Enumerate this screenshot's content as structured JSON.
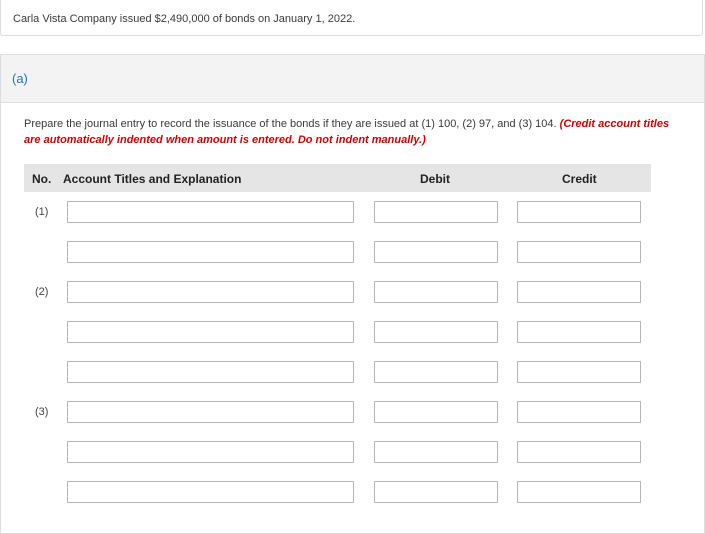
{
  "intro": {
    "text": "Carla Vista Company issued $2,490,000 of bonds on January 1, 2022."
  },
  "part": {
    "label": "(a)",
    "instructions": "Prepare the journal entry to record the issuance of the bonds if they are issued at (1) 100, (2) 97, and (3) 104.",
    "note": "(Credit account titles are automatically indented when amount is entered. Do not indent manually.)"
  },
  "table": {
    "headers": {
      "no": "No.",
      "account": "Account Titles and Explanation",
      "debit": "Debit",
      "credit": "Credit"
    },
    "rows": [
      {
        "no": "(1)",
        "account": "",
        "debit": "",
        "credit": ""
      },
      {
        "no": "",
        "account": "",
        "debit": "",
        "credit": ""
      },
      {
        "no": "(2)",
        "account": "",
        "debit": "",
        "credit": ""
      },
      {
        "no": "",
        "account": "",
        "debit": "",
        "credit": ""
      },
      {
        "no": "",
        "account": "",
        "debit": "",
        "credit": ""
      },
      {
        "no": "(3)",
        "account": "",
        "debit": "",
        "credit": ""
      },
      {
        "no": "",
        "account": "",
        "debit": "",
        "credit": ""
      },
      {
        "no": "",
        "account": "",
        "debit": "",
        "credit": ""
      }
    ]
  },
  "colors": {
    "part_label": "#2a6ebb",
    "note_red": "#d40000",
    "header_bg": "#e5e5e5"
  }
}
